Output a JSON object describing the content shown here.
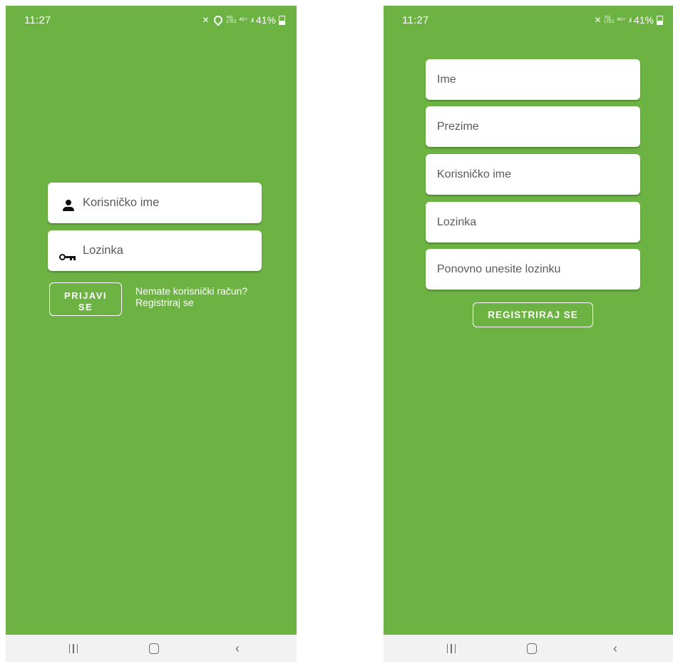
{
  "status_bar": {
    "time": "11:27",
    "battery": "41%",
    "network_top": "Vo)",
    "network_bottom": "LTE2",
    "network_gen": "4G+"
  },
  "login_screen": {
    "username_placeholder": "Korisničko ime",
    "password_placeholder": "Lozinka",
    "login_button_line1": "PRIJAVI",
    "login_button_line2": "SE",
    "no_account_text": "Nemate korisnički račun?",
    "register_link": "Registriraj se"
  },
  "register_screen": {
    "name_placeholder": "Ime",
    "surname_placeholder": "Prezime",
    "username_placeholder": "Korisničko ime",
    "password_placeholder": "Lozinka",
    "confirm_password_placeholder": "Ponovno unesite lozinku",
    "register_button": "REGISTRIRAJ SE"
  },
  "colors": {
    "background": "#6cb344",
    "field": "#ffffff",
    "navbar": "#f2f2f2"
  },
  "icons": [
    "person-icon",
    "key-icon",
    "mute-icon",
    "location-icon",
    "signal-icon",
    "battery-icon",
    "recent-apps-icon",
    "home-icon",
    "back-icon"
  ]
}
